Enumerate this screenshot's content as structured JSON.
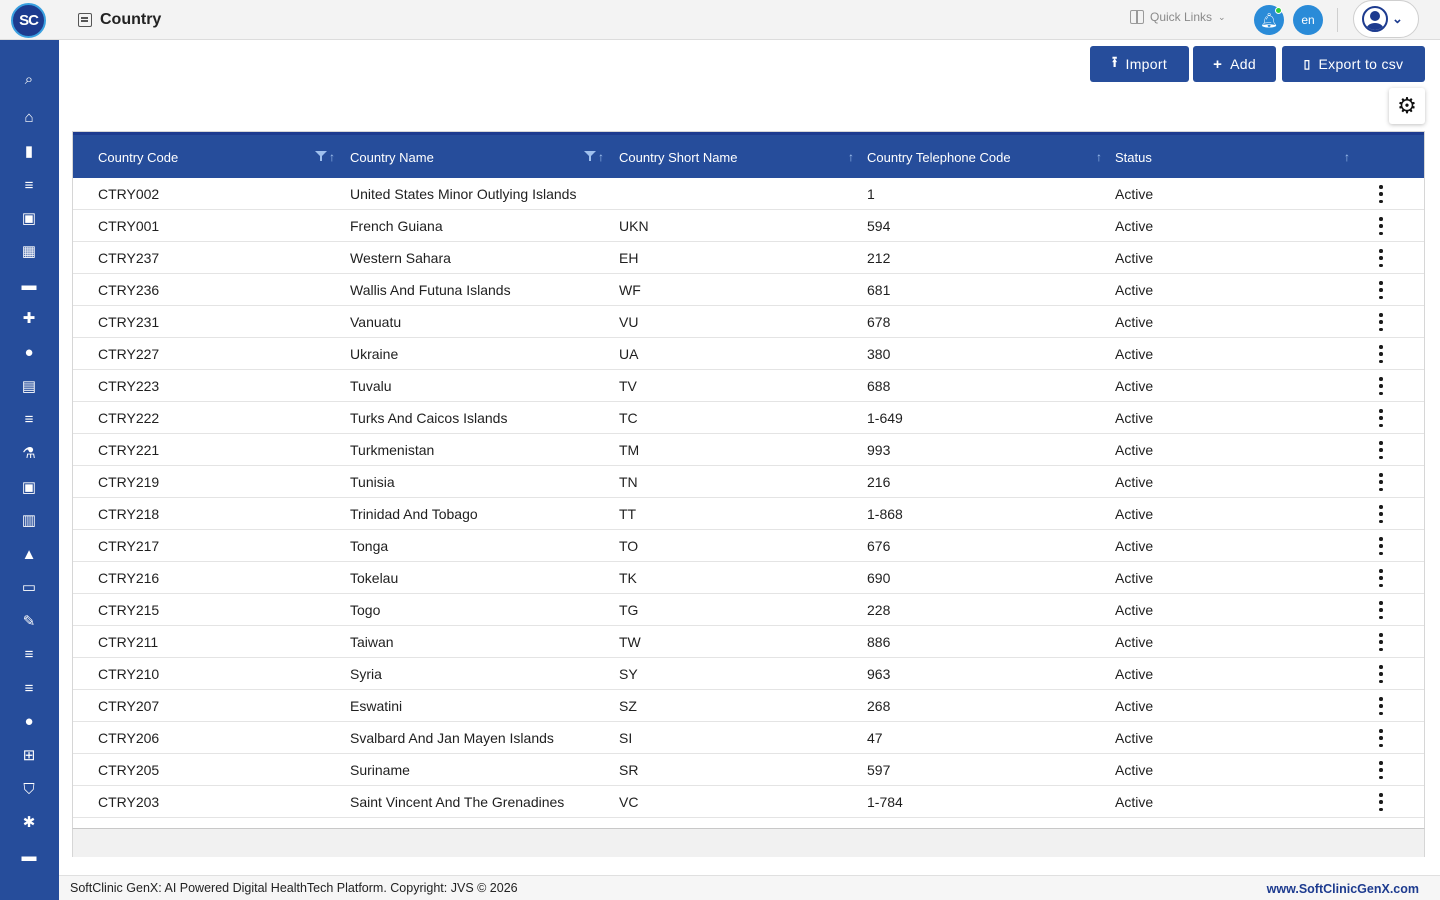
{
  "app": {
    "logo_text": "SC",
    "page_title": "Country"
  },
  "header": {
    "quick_links_label": "Quick Links",
    "language": "en"
  },
  "toolbar": {
    "import_label": "Import",
    "add_label": "Add",
    "export_label": "Export to csv"
  },
  "sidebar": {
    "items": [
      {
        "icon": "search-icon",
        "glyph": "⌕"
      },
      {
        "icon": "home-icon",
        "glyph": "⌂"
      },
      {
        "icon": "bar-chart-icon",
        "glyph": "▮"
      },
      {
        "icon": "menu-icon",
        "glyph": "≡"
      },
      {
        "icon": "medical-bag-icon",
        "glyph": "▣"
      },
      {
        "icon": "calendar-icon",
        "glyph": "▦"
      },
      {
        "icon": "bed-icon",
        "glyph": "▬"
      },
      {
        "icon": "medical-plus-icon",
        "glyph": "✚"
      },
      {
        "icon": "person-icon",
        "glyph": "●"
      },
      {
        "icon": "document-icon",
        "glyph": "▤"
      },
      {
        "icon": "list-icon",
        "glyph": "≡"
      },
      {
        "icon": "lab-icon",
        "glyph": "⚗"
      },
      {
        "icon": "pharmacy-icon",
        "glyph": "▣"
      },
      {
        "icon": "book-icon",
        "glyph": "▥"
      },
      {
        "icon": "building-icon",
        "glyph": "▲"
      },
      {
        "icon": "devices-icon",
        "glyph": "▭"
      },
      {
        "icon": "wrench-icon",
        "glyph": "✎"
      },
      {
        "icon": "list-icon",
        "glyph": "≡"
      },
      {
        "icon": "list-icon",
        "glyph": "≡"
      },
      {
        "icon": "drop-icon",
        "glyph": "●"
      },
      {
        "icon": "add-box-icon",
        "glyph": "⊞"
      },
      {
        "icon": "shield-icon",
        "glyph": "⛉"
      },
      {
        "icon": "network-icon",
        "glyph": "✱"
      },
      {
        "icon": "folder-icon",
        "glyph": "▬"
      }
    ]
  },
  "table": {
    "columns": [
      "Country Code",
      "Country Name",
      "Country Short Name",
      "Country Telephone Code",
      "Status"
    ],
    "rows": [
      {
        "code": "CTRY002",
        "name": "United States Minor Outlying Islands",
        "short": "",
        "tel": "1",
        "status": "Active"
      },
      {
        "code": "CTRY001",
        "name": "French Guiana",
        "short": "UKN",
        "tel": "594",
        "status": "Active"
      },
      {
        "code": "CTRY237",
        "name": "Western Sahara",
        "short": "EH",
        "tel": "212",
        "status": "Active"
      },
      {
        "code": "CTRY236",
        "name": "Wallis And Futuna Islands",
        "short": "WF",
        "tel": "681",
        "status": "Active"
      },
      {
        "code": "CTRY231",
        "name": "Vanuatu",
        "short": "VU",
        "tel": "678",
        "status": "Active"
      },
      {
        "code": "CTRY227",
        "name": "Ukraine",
        "short": "UA",
        "tel": "380",
        "status": "Active"
      },
      {
        "code": "CTRY223",
        "name": "Tuvalu",
        "short": "TV",
        "tel": "688",
        "status": "Active"
      },
      {
        "code": "CTRY222",
        "name": "Turks And Caicos Islands",
        "short": "TC",
        "tel": "1-649",
        "status": "Active"
      },
      {
        "code": "CTRY221",
        "name": "Turkmenistan",
        "short": "TM",
        "tel": "993",
        "status": "Active"
      },
      {
        "code": "CTRY219",
        "name": "Tunisia",
        "short": "TN",
        "tel": "216",
        "status": "Active"
      },
      {
        "code": "CTRY218",
        "name": "Trinidad And Tobago",
        "short": "TT",
        "tel": "1-868",
        "status": "Active"
      },
      {
        "code": "CTRY217",
        "name": "Tonga",
        "short": "TO",
        "tel": "676",
        "status": "Active"
      },
      {
        "code": "CTRY216",
        "name": "Tokelau",
        "short": "TK",
        "tel": "690",
        "status": "Active"
      },
      {
        "code": "CTRY215",
        "name": "Togo",
        "short": "TG",
        "tel": "228",
        "status": "Active"
      },
      {
        "code": "CTRY211",
        "name": "Taiwan",
        "short": "TW",
        "tel": "886",
        "status": "Active"
      },
      {
        "code": "CTRY210",
        "name": "Syria",
        "short": "SY",
        "tel": "963",
        "status": "Active"
      },
      {
        "code": "CTRY207",
        "name": "Eswatini",
        "short": "SZ",
        "tel": "268",
        "status": "Active"
      },
      {
        "code": "CTRY206",
        "name": "Svalbard And Jan Mayen Islands",
        "short": "SI",
        "tel": "47",
        "status": "Active"
      },
      {
        "code": "CTRY205",
        "name": "Suriname",
        "short": "SR",
        "tel": "597",
        "status": "Active"
      },
      {
        "code": "CTRY203",
        "name": "Saint Vincent And The Grenadines",
        "short": "VC",
        "tel": "1-784",
        "status": "Active"
      }
    ]
  },
  "footer": {
    "copyright": "SoftClinic GenX: AI Powered Digital HealthTech Platform. Copyright: JVS © 2026",
    "website": "www.SoftClinicGenX.com"
  },
  "colors": {
    "primary": "#264d9b",
    "accent": "#2a8bd8"
  }
}
